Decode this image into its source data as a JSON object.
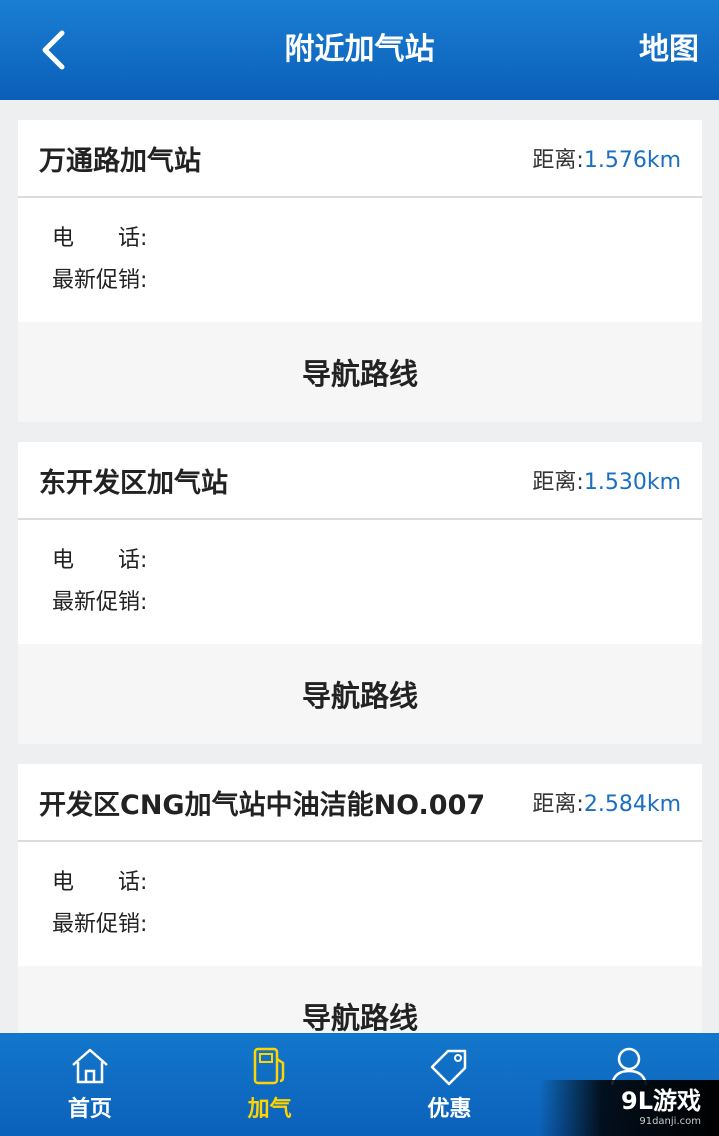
{
  "header": {
    "title": "附近加气站",
    "back_icon": "chevron-left-icon",
    "map_label": "地图"
  },
  "stations": [
    {
      "name": "万通路加气站",
      "distance_label": "距离:",
      "distance_value": "1.576km",
      "phone_label": "电　　话:",
      "promo_label": "最新促销:",
      "nav_label": "导航路线"
    },
    {
      "name": "东开发区加气站",
      "distance_label": "距离:",
      "distance_value": "1.530km",
      "phone_label": "电　　话:",
      "promo_label": "最新促销:",
      "nav_label": "导航路线"
    },
    {
      "name": "开发区CNG加气站中油洁能NO.007",
      "distance_label": "距离:",
      "distance_value": "2.584km",
      "phone_label": "电　　话:",
      "promo_label": "最新促销:",
      "nav_label": "导航路线"
    }
  ],
  "tabbar": {
    "tabs": [
      {
        "label": "首页",
        "icon": "home-icon",
        "active": false
      },
      {
        "label": "加气",
        "icon": "gas-pump-icon",
        "active": true
      },
      {
        "label": "优惠",
        "icon": "tag-icon",
        "active": false
      },
      {
        "label": "",
        "icon": "user-icon",
        "active": false
      }
    ]
  },
  "watermark": {
    "main": "9L游戏",
    "sub": "91danji.com"
  },
  "colors": {
    "header_blue": "#0b5fb8",
    "active_tab": "#ffd400",
    "distance_value": "#1a6fc0"
  }
}
